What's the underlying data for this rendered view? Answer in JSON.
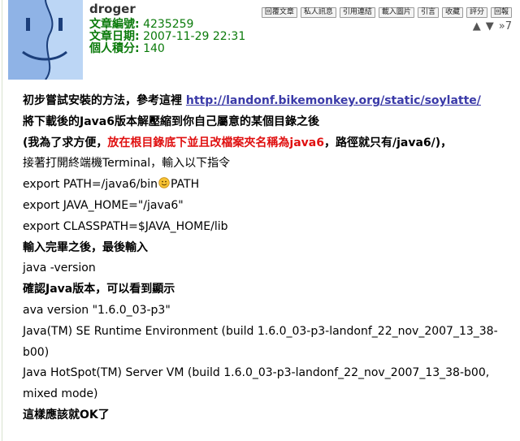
{
  "user": {
    "name": "droger",
    "article_id_label": "文章編號:",
    "article_id": "4235259",
    "date_label": "文章日期:",
    "date": "2007-11-29 22:31",
    "score_label": "個人積分:",
    "score": "140"
  },
  "toolbar": [
    "回覆文章",
    "私人訊息",
    "引用連結",
    "載入圖片",
    "引言",
    "收藏",
    "評分",
    "回報"
  ],
  "vote": {
    "up": "▲",
    "down": "▼",
    "jump": "»7"
  },
  "post": {
    "l1_text": "初步嘗試安裝的方法，參考這裡",
    "l1_link": "http://landonf.bikemonkey.org/static/soylatte/",
    "l2": "將下載後的Java6版本解壓縮到你自己屬意的某個目錄之後",
    "l3_a": "(我為了求方便，",
    "l3_red": "放在根目錄底下並且改檔案夾名稱為java6",
    "l3_b": "，路徑就只有/java6/)，",
    "l4": "接著打開終端機Terminal，輸入以下指令",
    "l5_a": "export PATH=/java6/bin",
    "l5_b": "PATH",
    "l6": "export JAVA_HOME=\"/java6\"",
    "l7": "export CLASSPATH=$JAVA_HOME/lib",
    "l8": "輸入完畢之後，最後輸入",
    "l9": "java -version",
    "l10": "確認Java版本，可以看到顯示",
    "l11": "ava version \"1.6.0_03-p3\"",
    "l12": "Java(TM) SE Runtime Environment (build 1.6.0_03-p3-landonf_22_nov_2007_13_38-b00)",
    "l13": "Java HotSpot(TM) Server VM (build 1.6.0_03-p3-landonf_22_nov_2007_13_38-b00, mixed mode)",
    "l14": "這樣應該就OK了"
  }
}
